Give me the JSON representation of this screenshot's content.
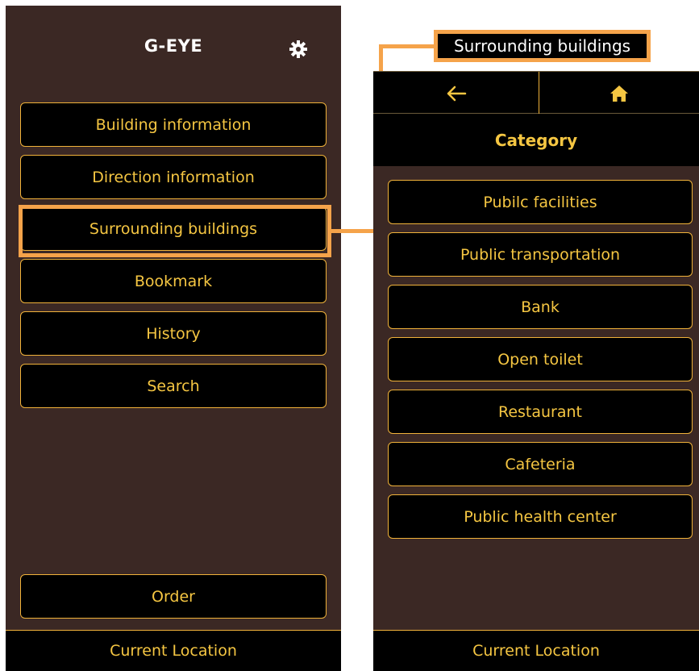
{
  "left": {
    "title": "G-EYE",
    "settings_icon": "gear-icon",
    "menu": [
      "Building information",
      "Direction information",
      "Surrounding buildings",
      "Bookmark",
      "History",
      "Search"
    ],
    "order_label": "Order",
    "current_location_label": "Current Location"
  },
  "right": {
    "callout_label": "Surrounding buildings",
    "back_icon": "arrow-left-icon",
    "home_icon": "home-icon",
    "category_title": "Category",
    "categories": [
      "Pubilc facilities",
      "Public transportation",
      "Bank",
      "Open toilet",
      "Restaurant",
      "Cafeteria",
      "Public health center"
    ],
    "current_location_label": "Current Location"
  },
  "colors": {
    "background": "#3b2824",
    "accent": "#f5c642",
    "highlight": "#f5a34a",
    "button_bg": "#000000"
  }
}
